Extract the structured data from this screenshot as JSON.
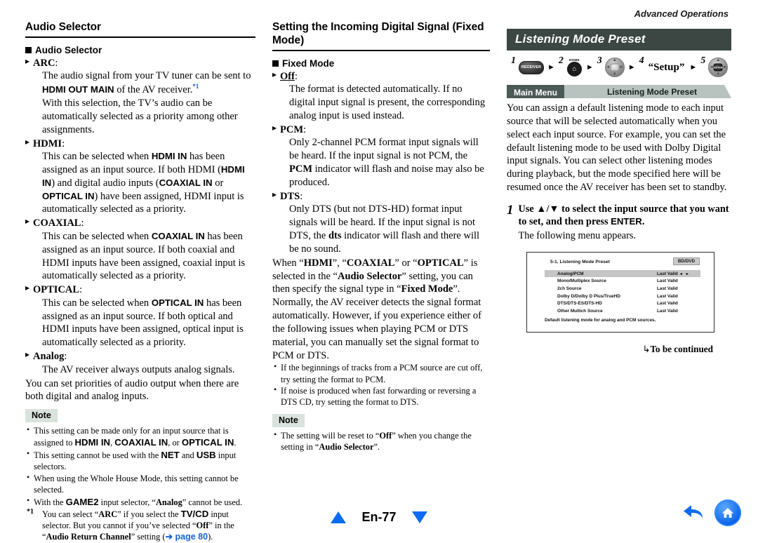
{
  "running_head": "Advanced Operations",
  "left": {
    "section_title": "Audio Selector",
    "sub_head": "Audio Selector",
    "entries": [
      {
        "term": "ARC",
        "term_suffix": ":",
        "lines": [
          "The audio signal from your TV tuner can be sent to",
          "HDMI OUT MAIN of the AV receiver.*1",
          "With this selection, the TV’s audio can be automatically selected as a priority among other assignments."
        ]
      },
      {
        "term": "HDMI",
        "term_suffix": ":",
        "lines": [
          "This can be selected when HDMI IN has been assigned as an input source. If both HDMI (HDMI IN) and digital audio inputs (COAXIAL IN or OPTICAL IN) have been assigned, HDMI input is automatically selected as a priority."
        ]
      },
      {
        "term": "COAXIAL",
        "term_suffix": ":",
        "lines": [
          "This can be selected when COAXIAL IN has been assigned as an input source. If both coaxial and HDMI inputs have been assigned, coaxial input is automatically selected as a priority."
        ]
      },
      {
        "term": "OPTICAL",
        "term_suffix": ":",
        "lines": [
          "This can be selected when OPTICAL IN has been assigned as an input source. If both optical and HDMI inputs have been assigned, optical input is automatically selected as a priority."
        ]
      },
      {
        "term": "Analog",
        "term_suffix": ":",
        "lines": [
          "The AV receiver always outputs analog signals."
        ]
      }
    ],
    "closing": "You can set priorities of audio output when there are both digital and analog inputs.",
    "note_label": "Note",
    "notes": [
      "This setting can be made only for an input source that is assigned to HDMI IN, COAXIAL IN, or OPTICAL IN.",
      "This setting cannot be used with the NET and USB input selectors.",
      "When using the Whole House Mode, this setting cannot be selected.",
      "With the GAME2 input selector, “Analog” cannot be used."
    ],
    "footnote_mark": "*1",
    "footnote": "You can select “ARC” if you select the TV/CD input selector. But you cannot if you’ve selected “Off” in the “Audio Return Channel” setting (→ page 80).",
    "footnote_link": "page 80"
  },
  "mid": {
    "section_title": "Setting the Incoming Digital Signal (Fixed Mode)",
    "sub_head": "Fixed Mode",
    "entries": [
      {
        "term": "Off",
        "term_suffix": ":",
        "lines": [
          "The format is detected automatically. If no digital input signal is present, the corresponding analog input is used instead."
        ]
      },
      {
        "term": "PCM",
        "term_suffix": ":",
        "lines": [
          "Only 2-channel PCM format input signals will be heard. If the input signal is not PCM, the PCM indicator will flash and noise may also be produced."
        ]
      },
      {
        "term": "DTS",
        "term_suffix": ":",
        "lines": [
          "Only DTS (but not DTS-HD) format input signals will be heard. If the input signal is not DTS, the dts indicator will flash and there will be no sound."
        ]
      }
    ],
    "para1": "When “HDMI”, “COAXIAL” or “OPTICAL” is selected in the “Audio Selector” setting, you can then specify the signal type in “Fixed Mode”.",
    "para2": "Normally, the AV receiver detects the signal format automatically. However, if you experience either of the following issues when playing PCM or DTS material, you can manually set the signal format to PCM or DTS.",
    "bullets": [
      "If the beginnings of tracks from a PCM source are cut off, try setting the format to PCM.",
      "If noise is produced when fast forwarding or reversing a DTS CD, try setting the format to DTS."
    ],
    "note_label": "Note",
    "notes": [
      "The setting will be reset to “Off” when you change the setting in “Audio Selector”."
    ]
  },
  "right": {
    "mode_bar_title": "Listening Mode Preset",
    "steps": [
      {
        "num": "1",
        "type": "receiver",
        "label": "RECEIVER"
      },
      {
        "num": "2",
        "type": "home",
        "label": "HOME"
      },
      {
        "num": "3",
        "type": "dpad",
        "label": ""
      },
      {
        "num": "4",
        "type": "word",
        "label": "“Setup”"
      },
      {
        "num": "5",
        "type": "enter",
        "label": "ENTER"
      }
    ],
    "breadcrumb": {
      "parent": "Main Menu",
      "current": "Listening Mode Preset"
    },
    "intro": "You can assign a default listening mode to each input source that will be selected automatically when you select each input source. For example, you can set the default listening mode to be used with Dolby Digital input signals. You can select other listening modes during playback, but the mode specified here will be resumed once the AV receiver has been set to standby.",
    "step1": {
      "number": "1",
      "instruction": "Use ▲/▼ to select the input source that you want to set, and then press ENTER.",
      "after": "The following menu appears."
    },
    "osd": {
      "title": "5-1. Listening Mode Preset",
      "badge": "BD/DVD",
      "arrows": "◄ ►",
      "rows": [
        {
          "name": "Analog/PCM",
          "value": "Last Valid",
          "selected": true
        },
        {
          "name": "Mono/Multiplex Source",
          "value": "Last Valid",
          "selected": false
        },
        {
          "name": "2ch Source",
          "value": "Last Valid",
          "selected": false
        },
        {
          "name": "Dolby D/Dolby D Plus/TrueHD",
          "value": "Last Valid",
          "selected": false
        },
        {
          "name": "DTS/DTS-ES/DTS-HD",
          "value": "Last Valid",
          "selected": false
        },
        {
          "name": "Other Multich Source",
          "value": "Last Valid",
          "selected": false
        }
      ],
      "footer": "Default listening mode for analog and PCM sources."
    },
    "continued": "To be continued"
  },
  "footer": {
    "page_label": "En-77",
    "up_icon": "triangle-up-icon",
    "down_icon": "triangle-down-icon",
    "back_icon": "back-arrow-icon",
    "home_icon": "home-icon"
  },
  "colors": {
    "accent_blue": "#0b6bf2",
    "mode_bar": "#3c4643",
    "crumb_parent": "#4c5a57",
    "crumb_current": "#b8c2bf",
    "note_tag": "#d9e2dd"
  }
}
